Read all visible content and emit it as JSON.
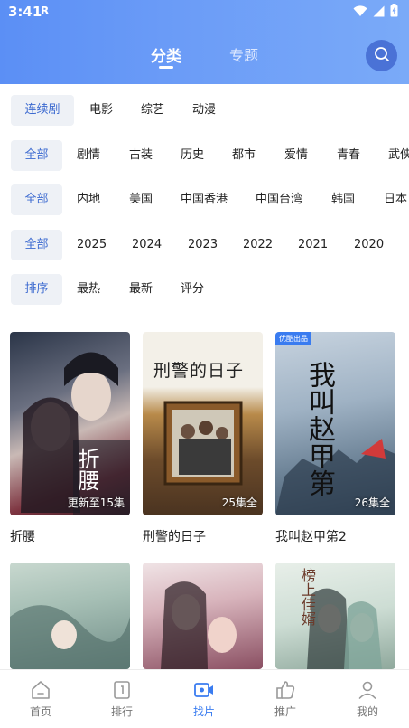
{
  "status": {
    "time": "3:41",
    "carrier_icon": "R"
  },
  "header": {
    "tabs": [
      {
        "label": "分类",
        "active": true
      },
      {
        "label": "专题",
        "active": false
      }
    ],
    "search_icon": "search-icon"
  },
  "filters": {
    "row1": [
      "连续剧",
      "电影",
      "综艺",
      "动漫"
    ],
    "row2": [
      "全部",
      "剧情",
      "古装",
      "历史",
      "都市",
      "爱情",
      "青春",
      "武侠"
    ],
    "row3": [
      "全部",
      "内地",
      "美国",
      "中国香港",
      "中国台湾",
      "韩国",
      "日本"
    ],
    "row4": [
      "全部",
      "2025",
      "2024",
      "2023",
      "2022",
      "2021",
      "2020"
    ],
    "row5": [
      "排序",
      "最热",
      "最新",
      "评分"
    ]
  },
  "videos": [
    {
      "title": "折腰",
      "episodes": "更新至15集"
    },
    {
      "title": "刑警的日子",
      "episodes": "25集全"
    },
    {
      "title": "我叫赵甲第2",
      "episodes": "26集全",
      "tag": "优酷出品"
    },
    {
      "title": "",
      "episodes": ""
    },
    {
      "title": "",
      "episodes": ""
    },
    {
      "title": "",
      "episodes": ""
    }
  ],
  "poster_text": {
    "p1": "折腰",
    "p2": "刑警的日子",
    "p3": "我叫赵甲第",
    "p6": "榜上佳婿"
  },
  "bottom_nav": [
    {
      "label": "首页",
      "icon": "home-icon"
    },
    {
      "label": "排行",
      "icon": "ranking-icon"
    },
    {
      "label": "找片",
      "icon": "find-video-icon",
      "active": true
    },
    {
      "label": "推广",
      "icon": "promote-icon"
    },
    {
      "label": "我的",
      "icon": "profile-icon"
    }
  ],
  "colors": {
    "accent": "#3a7cf0",
    "header_gradient_start": "#5b8ff5",
    "chip_selected_bg": "#eef1f6"
  }
}
